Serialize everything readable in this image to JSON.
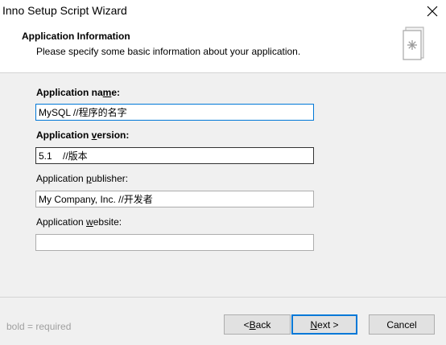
{
  "window": {
    "title": "Inno Setup Script Wizard",
    "close_icon": "close-icon"
  },
  "header": {
    "title": "Application Information",
    "subtitle": "Please specify some basic information about your application.",
    "icon": "wizard-page-icon"
  },
  "form": {
    "name": {
      "label_pre": "Application na",
      "label_key": "m",
      "label_post": "e:",
      "value": "MySQL //程序的名字",
      "required": true
    },
    "version": {
      "label_pre": "Application ",
      "label_key": "v",
      "label_post": "ersion:",
      "value": "5.1    //版本",
      "required": true
    },
    "publisher": {
      "label_pre": "Application ",
      "label_key": "p",
      "label_post": "ublisher:",
      "value": "My Company, Inc. //开发者",
      "required": false
    },
    "website": {
      "label_pre": "Application ",
      "label_key": "w",
      "label_post": "ebsite:",
      "value": "",
      "required": false
    }
  },
  "footer": {
    "legend_bold": "bold",
    "legend_rest": " = required",
    "back": {
      "pre": "< ",
      "key": "B",
      "post": "ack"
    },
    "next": {
      "pre": "",
      "key": "N",
      "post": "ext >"
    },
    "cancel": "Cancel"
  }
}
